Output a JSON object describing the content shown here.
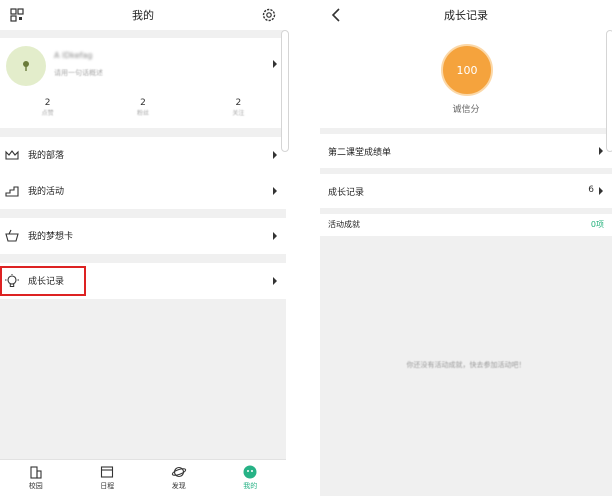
{
  "left": {
    "title": "我的",
    "profile": {
      "name": "A lDkefag",
      "signature": "请用一句话概述"
    },
    "stats": [
      {
        "value": "2",
        "label": "点赞"
      },
      {
        "value": "2",
        "label": "粉丝"
      },
      {
        "value": "2",
        "label": "关注"
      }
    ],
    "menu": [
      {
        "label": "我的部落"
      },
      {
        "label": "我的活动"
      },
      {
        "label": "我的梦想卡"
      },
      {
        "label": "成长记录"
      }
    ],
    "tabs": [
      {
        "label": "校园"
      },
      {
        "label": "日程"
      },
      {
        "label": "发现"
      },
      {
        "label": "我的"
      }
    ]
  },
  "right": {
    "title": "成长记录",
    "score": {
      "value": "100",
      "label": "诚信分"
    },
    "rows": [
      {
        "label": "第二课堂成绩单",
        "value": ""
      },
      {
        "label": "成长记录",
        "value": "6"
      },
      {
        "label": "活动成就",
        "value": "0项"
      }
    ],
    "empty_text": "你还没有活动成就，快去参加活动吧！"
  },
  "colors": {
    "accent_green": "#27b286",
    "score_orange": "#f5a33d",
    "highlight_red": "#d22222"
  }
}
